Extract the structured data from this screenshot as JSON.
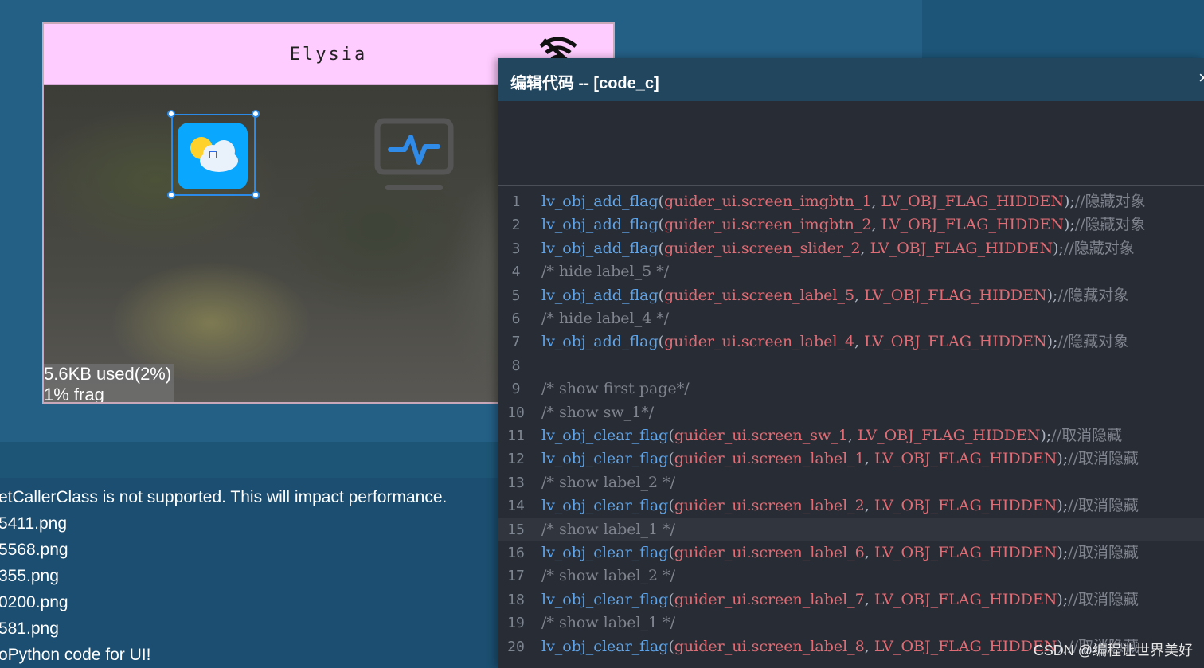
{
  "preview": {
    "app_title": "Elysia",
    "memory_used": "5.6KB used(2%)",
    "memory_frag": "1% frag"
  },
  "console": {
    "lines": [
      "etCallerClass is not supported. This will impact performance.",
      "5411.png",
      "5568.png",
      "355.png",
      "0200.png",
      "581.png",
      "oPython code for UI!"
    ]
  },
  "editor": {
    "title": "编辑代码 -- [code_c]",
    "close": "×",
    "lines": [
      {
        "n": "1",
        "fn": "lv_obj_add_flag",
        "arg": "guider_ui.screen_imgbtn_1",
        "flag": "LV_OBJ_FLAG_HIDDEN",
        "cm": "//隐藏对象"
      },
      {
        "n": "2",
        "fn": "lv_obj_add_flag",
        "arg": "guider_ui.screen_imgbtn_2",
        "flag": "LV_OBJ_FLAG_HIDDEN",
        "cm": "//隐藏对象"
      },
      {
        "n": "3",
        "fn": "lv_obj_add_flag",
        "arg": "guider_ui.screen_slider_2",
        "flag": "LV_OBJ_FLAG_HIDDEN",
        "cm": "//隐藏对象"
      },
      {
        "n": "4",
        "comment": "/* hide label_5 */"
      },
      {
        "n": "5",
        "fn": "lv_obj_add_flag",
        "arg": "guider_ui.screen_label_5",
        "flag": "LV_OBJ_FLAG_HIDDEN",
        "cm": "//隐藏对象"
      },
      {
        "n": "6",
        "comment": "/* hide label_4 */"
      },
      {
        "n": "7",
        "fn": "lv_obj_add_flag",
        "arg": "guider_ui.screen_label_4",
        "flag": "LV_OBJ_FLAG_HIDDEN",
        "cm": "//隐藏对象"
      },
      {
        "n": "8",
        "comment": ""
      },
      {
        "n": "9",
        "comment": "/* show first page*/"
      },
      {
        "n": "10",
        "comment": "/* show sw_1*/"
      },
      {
        "n": "11",
        "fn": "lv_obj_clear_flag",
        "arg": "guider_ui.screen_sw_1",
        "flag": "LV_OBJ_FLAG_HIDDEN",
        "cm": "//取消隐藏"
      },
      {
        "n": "12",
        "fn": "lv_obj_clear_flag",
        "arg": "guider_ui.screen_label_1",
        "flag": "LV_OBJ_FLAG_HIDDEN",
        "cm": "//取消隐藏"
      },
      {
        "n": "13",
        "comment": "/* show label_2 */"
      },
      {
        "n": "14",
        "fn": "lv_obj_clear_flag",
        "arg": "guider_ui.screen_label_2",
        "flag": "LV_OBJ_FLAG_HIDDEN",
        "cm": "//取消隐藏"
      },
      {
        "n": "15",
        "comment": "/* show label_1 */"
      },
      {
        "n": "16",
        "fn": "lv_obj_clear_flag",
        "arg": "guider_ui.screen_label_6",
        "flag": "LV_OBJ_FLAG_HIDDEN",
        "cm": "//取消隐藏"
      },
      {
        "n": "17",
        "comment": "/* show label_2 */"
      },
      {
        "n": "18",
        "fn": "lv_obj_clear_flag",
        "arg": "guider_ui.screen_label_7",
        "flag": "LV_OBJ_FLAG_HIDDEN",
        "cm": "//取消隐藏"
      },
      {
        "n": "19",
        "comment": "/* show label_1 */"
      },
      {
        "n": "20",
        "fn": "lv_obj_clear_flag",
        "arg": "guider_ui.screen_label_8",
        "flag": "LV_OBJ_FLAG_HIDDEN",
        "cm": "//取消隐藏"
      }
    ]
  },
  "watermark": "CSDN @编程让世界美好"
}
